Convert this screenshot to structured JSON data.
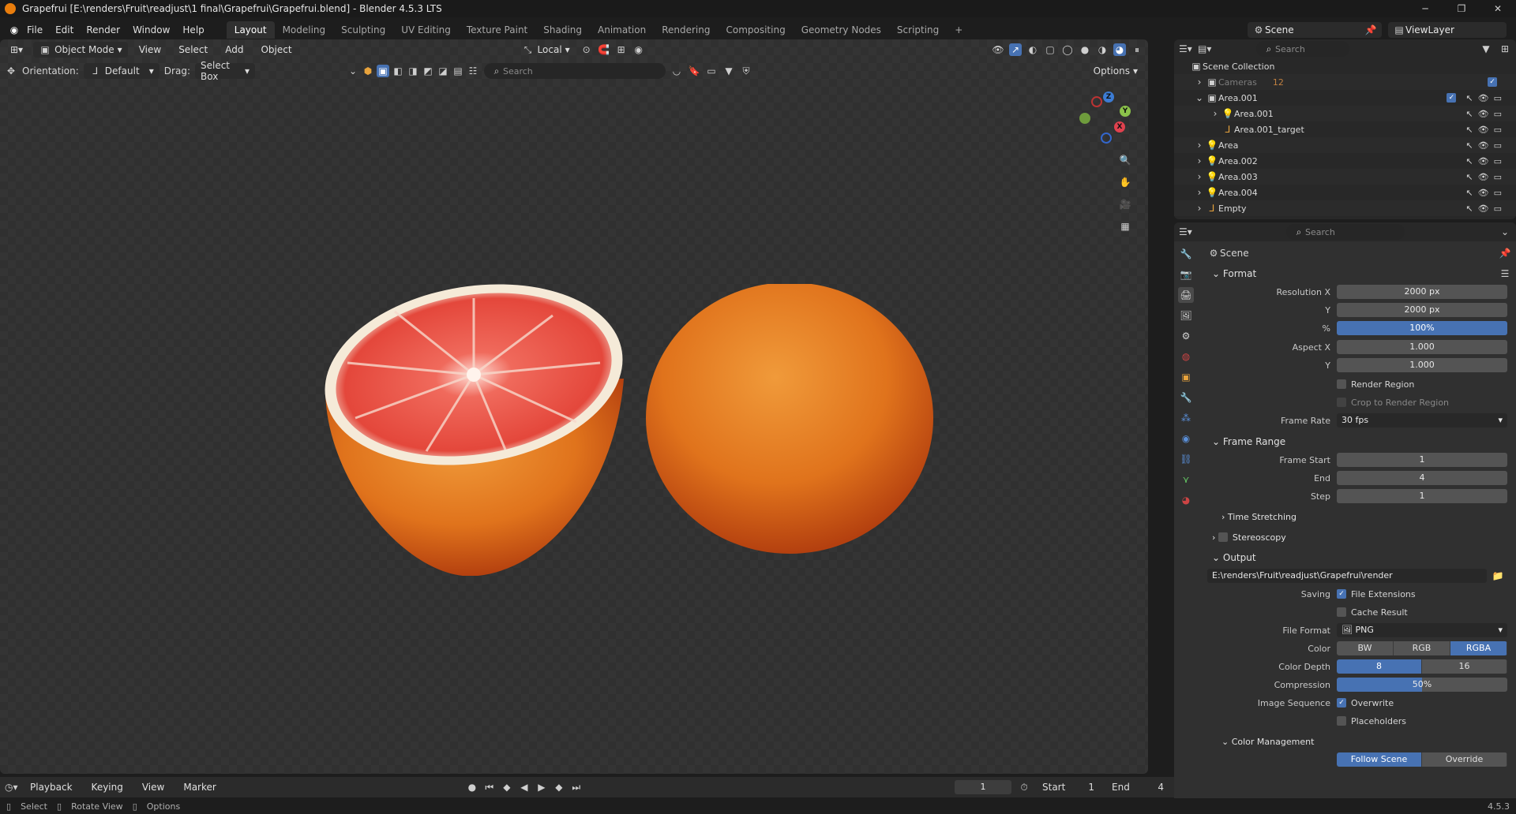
{
  "window": {
    "title": "Grapefrui [E:\\renders\\Fruit\\readjust\\1 final\\Grapefrui\\Grapefrui.blend] - Blender 4.5.3 LTS"
  },
  "menus": [
    "File",
    "Edit",
    "Render",
    "Window",
    "Help"
  ],
  "workspaces": [
    "Layout",
    "Modeling",
    "Sculpting",
    "UV Editing",
    "Texture Paint",
    "Shading",
    "Animation",
    "Rendering",
    "Compositing",
    "Geometry Nodes",
    "Scripting"
  ],
  "active_workspace": "Layout",
  "scene_selector": {
    "label": "Scene"
  },
  "viewlayer_selector": {
    "label": "ViewLayer"
  },
  "viewport": {
    "mode": "Object Mode",
    "menus": [
      "View",
      "Select",
      "Add",
      "Object"
    ],
    "pivot": "Local",
    "orientation_label": "Orientation:",
    "orientation_value": "Default",
    "drag_label": "Drag:",
    "drag_value": "Select Box",
    "search_placeholder": "Search",
    "options_label": "Options",
    "gizmo": {
      "x": "X",
      "y": "Y",
      "z": "Z"
    }
  },
  "outliner": {
    "search_placeholder": "Search",
    "root": "Scene Collection",
    "items": [
      {
        "name": "Cameras",
        "badge": "12",
        "dim": true
      },
      {
        "name": "Area.001"
      },
      {
        "name": "Area.001",
        "child": true
      },
      {
        "name": "Area.001_target",
        "child": true
      },
      {
        "name": "Area"
      },
      {
        "name": "Area.002"
      },
      {
        "name": "Area.003"
      },
      {
        "name": "Area.004"
      },
      {
        "name": "Empty"
      }
    ]
  },
  "properties": {
    "search_placeholder": "Search",
    "context": "Scene",
    "format": {
      "title": "Format",
      "resolution_x_label": "Resolution X",
      "resolution_x": "2000 px",
      "resolution_y_label": "Y",
      "resolution_y": "2000 px",
      "percent_label": "%",
      "percent": "100%",
      "aspect_x_label": "Aspect X",
      "aspect_x": "1.000",
      "aspect_y_label": "Y",
      "aspect_y": "1.000",
      "render_region": "Render Region",
      "crop_region": "Crop to Render Region",
      "frame_rate_label": "Frame Rate",
      "frame_rate": "30 fps"
    },
    "frame_range": {
      "title": "Frame Range",
      "start_label": "Frame Start",
      "start": "1",
      "end_label": "End",
      "end": "4",
      "step_label": "Step",
      "step": "1",
      "time_stretching": "Time Stretching"
    },
    "stereoscopy": "Stereoscopy",
    "output": {
      "title": "Output",
      "path": "E:\\renders\\Fruit\\readjust\\Grapefrui\\render",
      "saving_label": "Saving",
      "file_extensions": "File Extensions",
      "cache_result": "Cache Result",
      "file_format_label": "File Format",
      "file_format": "PNG",
      "color_label": "Color",
      "color_options": [
        "BW",
        "RGB",
        "RGBA"
      ],
      "color_selected": "RGBA",
      "depth_label": "Color Depth",
      "depth_options": [
        "8",
        "16"
      ],
      "depth_selected": "8",
      "compression_label": "Compression",
      "compression": "50%",
      "compression_value": 0.5,
      "image_sequence_label": "Image Sequence",
      "overwrite": "Overwrite",
      "placeholders": "Placeholders",
      "color_management": "Color Management",
      "follow_scene": "Follow Scene",
      "override": "Override"
    }
  },
  "timeline": {
    "menus": [
      "Playback",
      "Keying",
      "View",
      "Marker"
    ],
    "current_frame": "1",
    "start_label": "Start",
    "start": "1",
    "end_label": "End",
    "end": "4"
  },
  "statusbar": {
    "items": [
      "Select",
      "Rotate View",
      "Options"
    ],
    "version": "4.5.3"
  },
  "colors": {
    "accent": "#4772b3",
    "panel": "#303030",
    "header": "#1d1d1d"
  }
}
